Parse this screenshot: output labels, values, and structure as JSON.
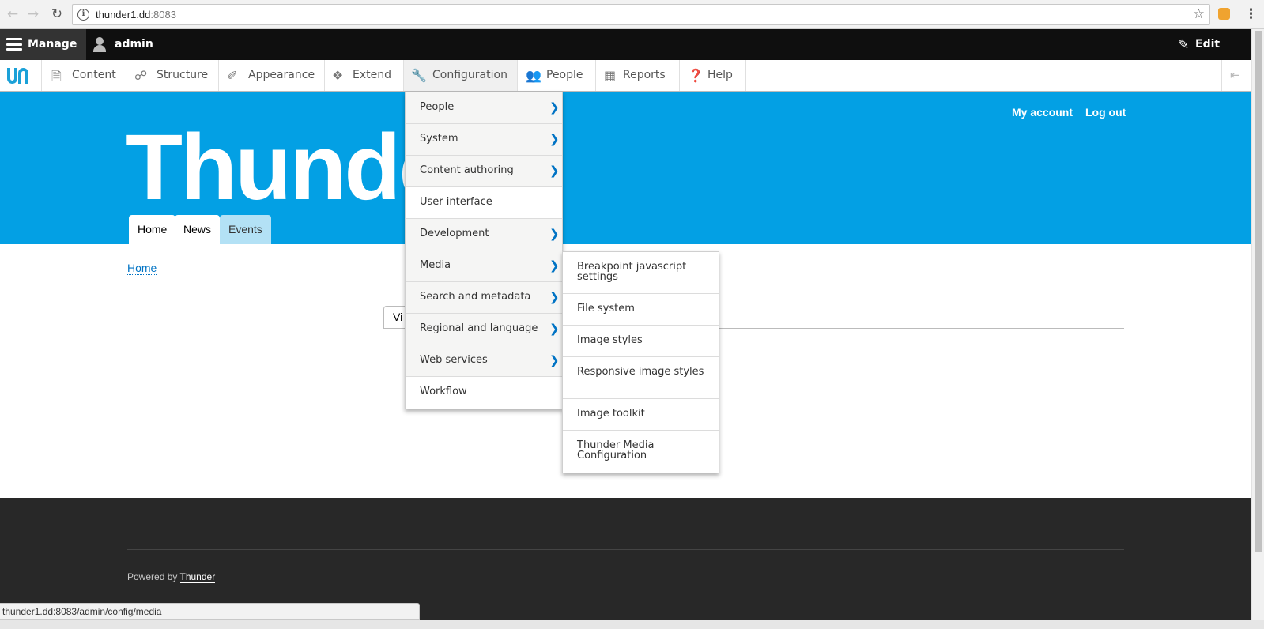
{
  "browser": {
    "url_host": "thunder1.dd",
    "url_port": ":8083",
    "status_url": "thunder1.dd:8083/admin/config/media"
  },
  "toolbar": {
    "manage": "Manage",
    "user": "admin",
    "edit": "Edit",
    "items": [
      {
        "label": "Content",
        "icon": "document-icon"
      },
      {
        "label": "Structure",
        "icon": "sitemap-icon"
      },
      {
        "label": "Appearance",
        "icon": "paintbrush-icon"
      },
      {
        "label": "Extend",
        "icon": "puzzle-icon"
      },
      {
        "label": "Configuration",
        "icon": "wrench-icon"
      },
      {
        "label": "People",
        "icon": "people-icon"
      },
      {
        "label": "Reports",
        "icon": "bar-chart-icon"
      },
      {
        "label": "Help",
        "icon": "help-icon"
      }
    ]
  },
  "header": {
    "site_name": "Thunder",
    "secondary": [
      "My account",
      "Log out"
    ],
    "tabs": [
      "Home",
      "News",
      "Events"
    ]
  },
  "content": {
    "breadcrumb": "Home",
    "local_tab": "Vi"
  },
  "config_menu": [
    {
      "label": "People",
      "has_children": true
    },
    {
      "label": "System",
      "has_children": true
    },
    {
      "label": "Content authoring",
      "has_children": true
    },
    {
      "label": "User interface",
      "has_children": false
    },
    {
      "label": "Development",
      "has_children": true
    },
    {
      "label": "Media",
      "has_children": true
    },
    {
      "label": "Search and metadata",
      "has_children": true
    },
    {
      "label": "Regional and language",
      "has_children": true
    },
    {
      "label": "Web services",
      "has_children": true
    },
    {
      "label": "Workflow",
      "has_children": false
    }
  ],
  "media_menu": [
    "Breakpoint javascript settings",
    "File system",
    "Image styles",
    "Responsive image styles",
    "Image toolkit",
    "Thunder Media Configuration"
  ],
  "footer": {
    "prefix": "Powered by",
    "link": "Thunder"
  },
  "colors": {
    "header_blue": "#03a0e4",
    "toolbar_black": "#0f0f0f",
    "link_blue": "#0073c4",
    "footer_dark": "#282828"
  }
}
